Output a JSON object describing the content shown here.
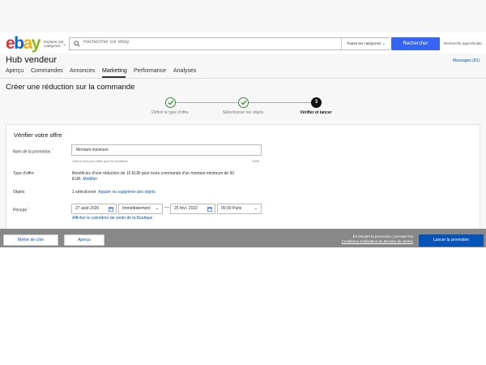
{
  "header": {
    "logo": {
      "e": "e",
      "b": "b",
      "a": "a",
      "y": "y"
    },
    "explore_label": "Explorer par catégories",
    "search_placeholder": "Rechercher sur eBay",
    "category_select": "Toutes les catégories",
    "search_button": "Rechercher",
    "advanced_search": "Recherche approfondie"
  },
  "hub": {
    "title": "Hub vendeur",
    "messages": "Messages (81)"
  },
  "nav": {
    "items": [
      "Aperçu",
      "Commandes",
      "Annonces",
      "Marketing",
      "Performance",
      "Analyses"
    ],
    "active": "Marketing"
  },
  "page_heading": "Créer une réduction sur la commande",
  "stepper": {
    "steps": [
      {
        "label": "Définir le type d'offre",
        "state": "done"
      },
      {
        "label": "Sélectionner les objets",
        "state": "done"
      },
      {
        "label": "Vérifier et lancer",
        "state": "current",
        "number": "3"
      }
    ]
  },
  "form": {
    "title": "Vérifier votre offre",
    "promo_name_label": "Nom de la promotion",
    "promo_name_value": "Montant minimum",
    "promo_hint": "Cela ne sera pas visible pour les acheteurs",
    "promo_counter": "15/90",
    "offer_type_label": "Type d'offre",
    "offer_type_text": "Bénéficiez d'une réduction de 10 EUR pour toute commande d'un montant minimum de 50 EUR",
    "modify_link": "Modifier",
    "objects_label": "Objets",
    "objects_count": "1 sélectionné",
    "objects_link": "Ajouter ou supprimer des objets",
    "period_label": "Période",
    "start_date": "27 août 2020",
    "start_mode": "Immédiatement",
    "end_date": "25 févr. 2022",
    "end_time": "00:00 Paris",
    "calendar_link": "Afficher le calendrier de vente de la Boutique",
    "required_mark": "*"
  },
  "footer": {
    "save_button": "Mettre de côté",
    "preview_button": "Aperçu",
    "terms_prefix": "En lançant la promotion, j'accepte les",
    "terms_link": "Conditions d'utilisation du Booster de ventes",
    "launch_button": "Lancer la promotion"
  },
  "colors": {
    "primary_blue": "#3665f3",
    "link_blue": "#0654ba",
    "success_green": "#2e8b2e",
    "footer_gray": "#888888"
  }
}
